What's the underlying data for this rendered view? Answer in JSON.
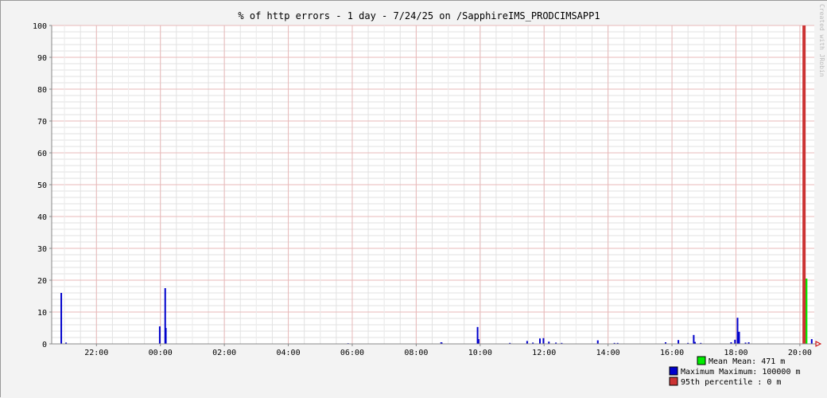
{
  "chart_data": {
    "type": "bar",
    "title": "% of http errors - 1 day - 7/24/25 on /SapphireIMS_PRODCIMSAPP1",
    "watermark": "Created with JRobin",
    "ylim": [
      0,
      100
    ],
    "yticks": [
      0,
      10,
      20,
      30,
      40,
      50,
      60,
      70,
      80,
      90,
      100
    ],
    "xlim": [
      -3.4,
      20.45
    ],
    "xticks": [
      {
        "t": -2,
        "label": "22:00"
      },
      {
        "t": 0,
        "label": "00:00"
      },
      {
        "t": 2,
        "label": "02:00"
      },
      {
        "t": 4,
        "label": "04:00"
      },
      {
        "t": 6,
        "label": "06:00"
      },
      {
        "t": 8,
        "label": "08:00"
      },
      {
        "t": 10,
        "label": "10:00"
      },
      {
        "t": 12,
        "label": "12:00"
      },
      {
        "t": 14,
        "label": "14:00"
      },
      {
        "t": 16,
        "label": "16:00"
      },
      {
        "t": 18,
        "label": "18:00"
      },
      {
        "t": 20,
        "label": "20:00"
      }
    ],
    "grid": "on",
    "legend_placement": "bottom-right",
    "series": [
      {
        "name": "Mean",
        "color": "#00ee00",
        "points": [
          [
            20.18,
            20.5
          ],
          [
            20.21,
            20.5
          ]
        ]
      },
      {
        "name": "Maximum",
        "color": "#0000cc",
        "points": [
          [
            -3.1,
            16
          ],
          [
            -2.95,
            0.4
          ],
          [
            -0.02,
            5.5
          ],
          [
            0.15,
            17.5
          ],
          [
            0.17,
            5
          ],
          [
            5.87,
            0.2
          ],
          [
            8.78,
            0.5
          ],
          [
            8.8,
            0.4
          ],
          [
            9.92,
            5.3
          ],
          [
            9.95,
            1.5
          ],
          [
            10.93,
            0.3
          ],
          [
            11.47,
            0.9
          ],
          [
            11.65,
            0.4
          ],
          [
            11.87,
            1.7
          ],
          [
            11.98,
            1.8
          ],
          [
            12.15,
            0.7
          ],
          [
            12.37,
            0.4
          ],
          [
            12.55,
            0.3
          ],
          [
            13.68,
            1.1
          ],
          [
            14.2,
            0.3
          ],
          [
            14.3,
            0.3
          ],
          [
            15.8,
            0.5
          ],
          [
            16.2,
            1.2
          ],
          [
            16.5,
            0.3
          ],
          [
            16.68,
            2.8
          ],
          [
            16.72,
            0.6
          ],
          [
            16.9,
            0.3
          ],
          [
            17.85,
            0.5
          ],
          [
            17.97,
            1.3
          ],
          [
            18.05,
            8.2
          ],
          [
            18.1,
            3.8
          ],
          [
            18.3,
            0.4
          ],
          [
            18.4,
            0.5
          ],
          [
            20.37,
            1.5
          ]
        ]
      },
      {
        "name": "95th percentile",
        "color": "#cc3333",
        "points": [
          [
            20.13,
            100
          ]
        ]
      }
    ],
    "legend": [
      {
        "label": "Mean",
        "text": "Mean  Mean:       471 m",
        "color": "#00ee00"
      },
      {
        "label": "Maximum",
        "text": "Maximum  Maximum:    100000 m",
        "color": "#0000cc"
      },
      {
        "label": "95th percentile",
        "text": "95th percentile  :          0 m",
        "color": "#cc3333"
      }
    ]
  }
}
